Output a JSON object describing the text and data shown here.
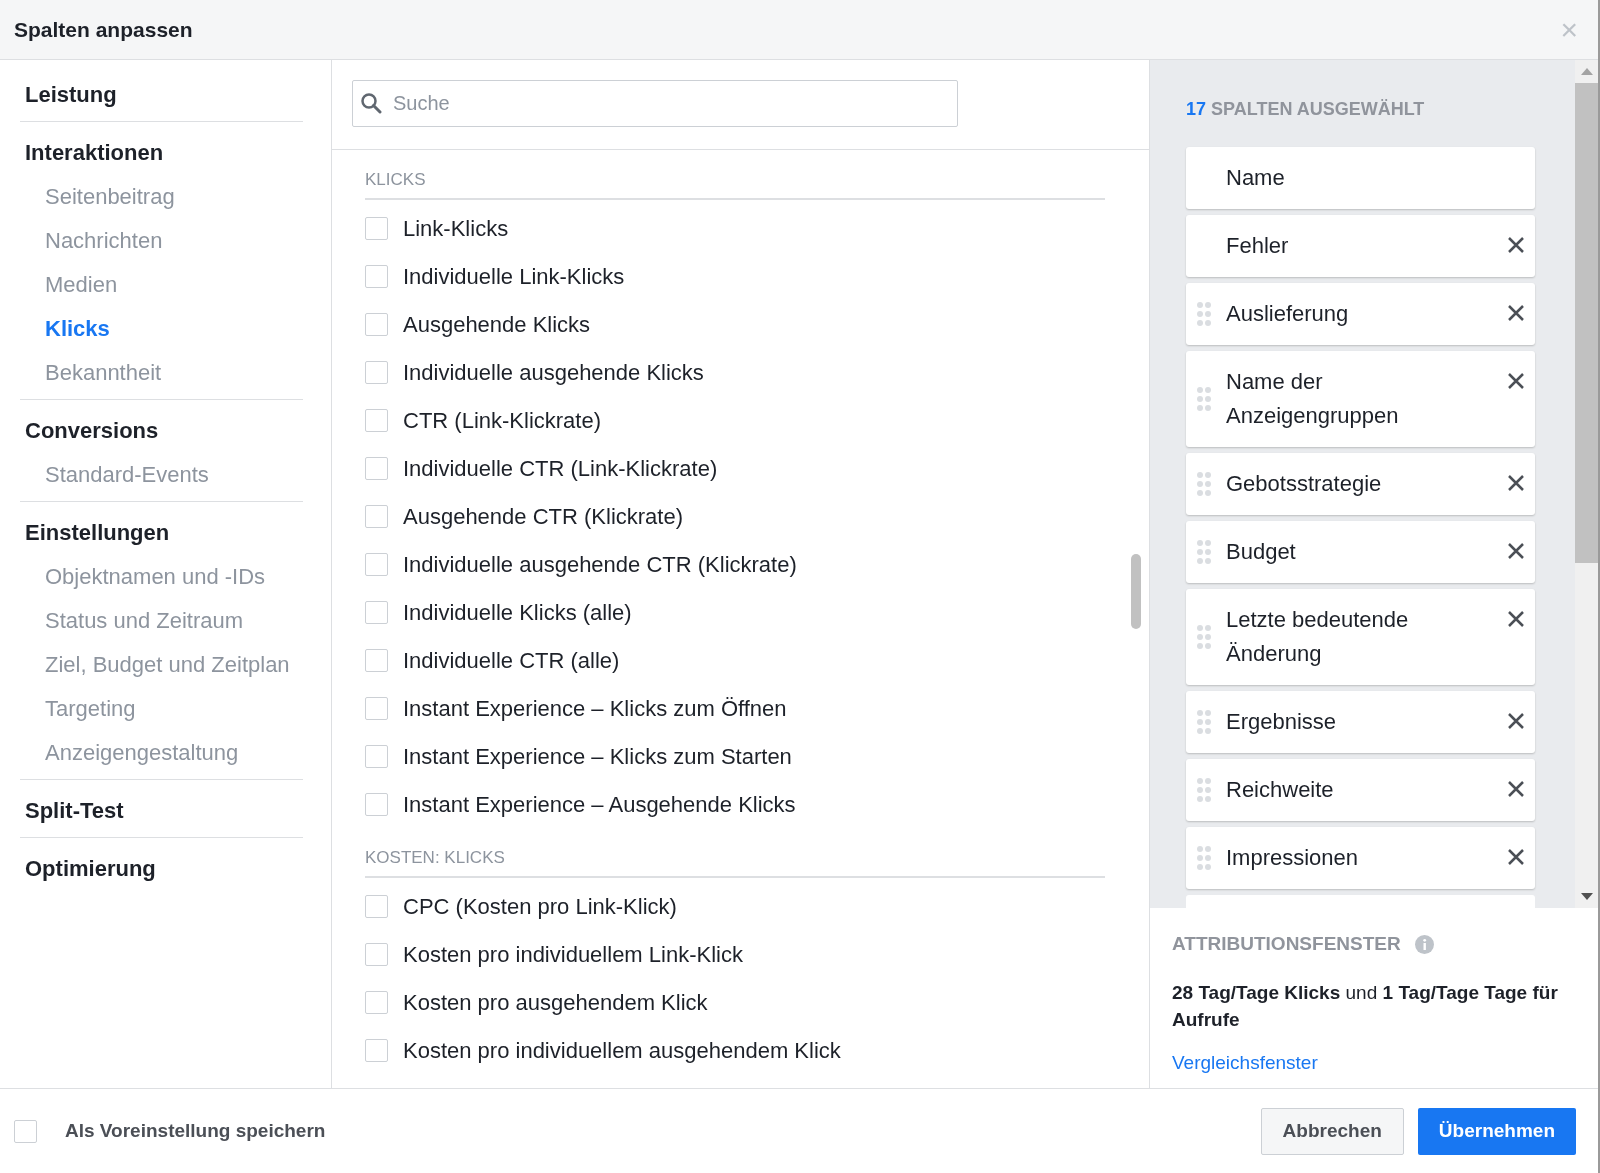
{
  "dialog": {
    "title": "Spalten anpassen",
    "close": "×"
  },
  "sidebar": [
    {
      "label": "Leistung"
    },
    {
      "label": "Interaktionen",
      "children": [
        {
          "label": "Seitenbeitrag",
          "selected": false
        },
        {
          "label": "Nachrichten",
          "selected": false
        },
        {
          "label": "Medien",
          "selected": false
        },
        {
          "label": "Klicks",
          "selected": true
        },
        {
          "label": "Bekanntheit",
          "selected": false
        }
      ]
    },
    {
      "label": "Conversions",
      "children": [
        {
          "label": "Standard-Events",
          "selected": false
        }
      ]
    },
    {
      "label": "Einstellungen",
      "children": [
        {
          "label": "Objektnamen und -IDs",
          "selected": false
        },
        {
          "label": "Status und Zeitraum",
          "selected": false
        },
        {
          "label": "Ziel, Budget und Zeitplan",
          "selected": false
        },
        {
          "label": "Targeting",
          "selected": false
        },
        {
          "label": "Anzeigengestaltung",
          "selected": false
        }
      ]
    },
    {
      "label": "Split-Test"
    },
    {
      "label": "Optimierung"
    }
  ],
  "search": {
    "placeholder": "Suche"
  },
  "groups": [
    {
      "heading": "KLICKS",
      "items": [
        {
          "label": "Link-Klicks",
          "checked": false
        },
        {
          "label": "Individuelle Link-Klicks",
          "checked": false
        },
        {
          "label": "Ausgehende Klicks",
          "checked": false
        },
        {
          "label": "Individuelle ausgehende Klicks",
          "checked": false
        },
        {
          "label": "CTR (Link-Klickrate)",
          "checked": false
        },
        {
          "label": "Individuelle CTR (Link-Klickrate)",
          "checked": false
        },
        {
          "label": "Ausgehende CTR (Klickrate)",
          "checked": false
        },
        {
          "label": "Individuelle ausgehende CTR (Klickrate)",
          "checked": false
        },
        {
          "label": "Individuelle Klicks (alle)",
          "checked": false
        },
        {
          "label": "Individuelle CTR (alle)",
          "checked": false
        },
        {
          "label": "Instant Experience – Klicks zum Öffnen",
          "checked": false
        },
        {
          "label": "Instant Experience – Klicks zum Starten",
          "checked": false
        },
        {
          "label": "Instant Experience – Ausgehende Klicks",
          "checked": false
        }
      ]
    },
    {
      "heading": "KOSTEN: KLICKS",
      "items": [
        {
          "label": "CPC (Kosten pro Link-Klick)",
          "checked": false
        },
        {
          "label": "Kosten pro individuellem Link-Klick",
          "checked": false
        },
        {
          "label": "Kosten pro ausgehendem Klick",
          "checked": false
        },
        {
          "label": "Kosten pro individuellem ausgehendem Klick",
          "checked": false
        }
      ]
    }
  ],
  "selected_columns": {
    "count": "17",
    "title": "SPALTEN AUSGEWÄHLT",
    "items": [
      {
        "label": "Name",
        "draggable": false,
        "removable": false
      },
      {
        "label": "Fehler",
        "draggable": false,
        "removable": true
      },
      {
        "label": "Auslieferung",
        "draggable": true,
        "removable": true
      },
      {
        "label": "Name der Anzeigengruppen",
        "draggable": true,
        "removable": true
      },
      {
        "label": "Gebotsstrategie",
        "draggable": true,
        "removable": true
      },
      {
        "label": "Budget",
        "draggable": true,
        "removable": true
      },
      {
        "label": "Letzte bedeutende Änderung",
        "draggable": true,
        "removable": true
      },
      {
        "label": "Ergebnisse",
        "draggable": true,
        "removable": true
      },
      {
        "label": "Reichweite",
        "draggable": true,
        "removable": true
      },
      {
        "label": "Impressionen",
        "draggable": true,
        "removable": true
      }
    ]
  },
  "attribution": {
    "title": "ATTRIBUTIONSFENSTER",
    "text": "**28 Tag/Tage Klicks** und **1 Tag/Tage Tage für Aufrufe**",
    "link": "Vergleichsfenster"
  },
  "footer": {
    "save_default": {
      "label": "Als Voreinstellung speichern",
      "checked": false
    },
    "cancel": "Abbrechen",
    "apply": "Übernehmen"
  }
}
